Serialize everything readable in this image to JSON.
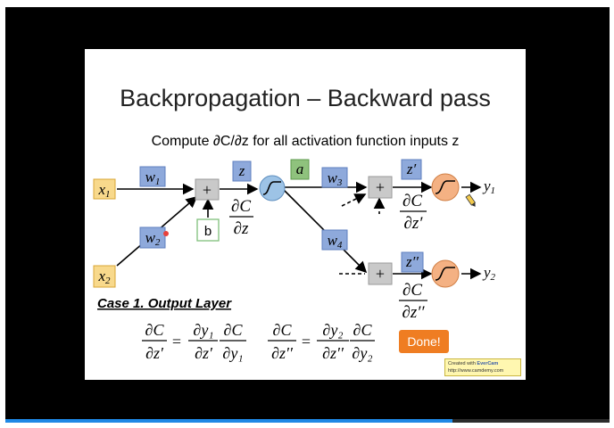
{
  "player": {
    "progress_fraction": 0.74,
    "accent_color": "#1e88e5"
  },
  "slide": {
    "title": "Backpropagation – Backward pass",
    "subtitle": "Compute ∂C/∂z for all activation function inputs z",
    "case_label": "Case 1. Output Layer"
  },
  "diagram": {
    "inputs": {
      "x1": "x",
      "x1_sub": "1",
      "x2": "x",
      "x2_sub": "2"
    },
    "weights": {
      "w": "w",
      "w1_sub": "1",
      "w2_sub": "2",
      "w3_sub": "3",
      "w4_sub": "4"
    },
    "plus": "+",
    "bias": "b",
    "z": "z",
    "a": "a",
    "z_prime": "z′",
    "z_double_prime": "z′′",
    "dC": "∂C",
    "dz": "∂z",
    "dz_prime": "∂z′",
    "dz_double_prime": "∂z′′",
    "outputs": {
      "y": "y",
      "y1_sub": "1",
      "y2_sub": "2"
    }
  },
  "equations": {
    "eq1": {
      "lhs_num": "∂C",
      "lhs_den": "∂z′",
      "eq": "=",
      "f1_num": "∂y₁",
      "f1_den": "∂z′",
      "f2_num": "∂C",
      "f2_den": "∂y₁"
    },
    "eq2": {
      "lhs_num": "∂C",
      "lhs_den": "∂z′′",
      "eq": "=",
      "f1_num": "∂y₂",
      "f1_den": "∂z′′",
      "f2_num": "∂C",
      "f2_den": "∂y₂"
    }
  },
  "done_button": {
    "label": "Done!"
  },
  "watermark": {
    "line1_prefix": "Created with ",
    "brand": "EverCam",
    "line2": "http://www.camdemy.com"
  },
  "colors": {
    "input_box": "#f8d98c",
    "weight_box": "#8ea9db",
    "a_box": "#8fc27d",
    "sum_box": "#c9c9c9",
    "neuron_blue": "#9dc3e6",
    "neuron_orange": "#f4b183",
    "done_orange": "#ef7d22"
  }
}
